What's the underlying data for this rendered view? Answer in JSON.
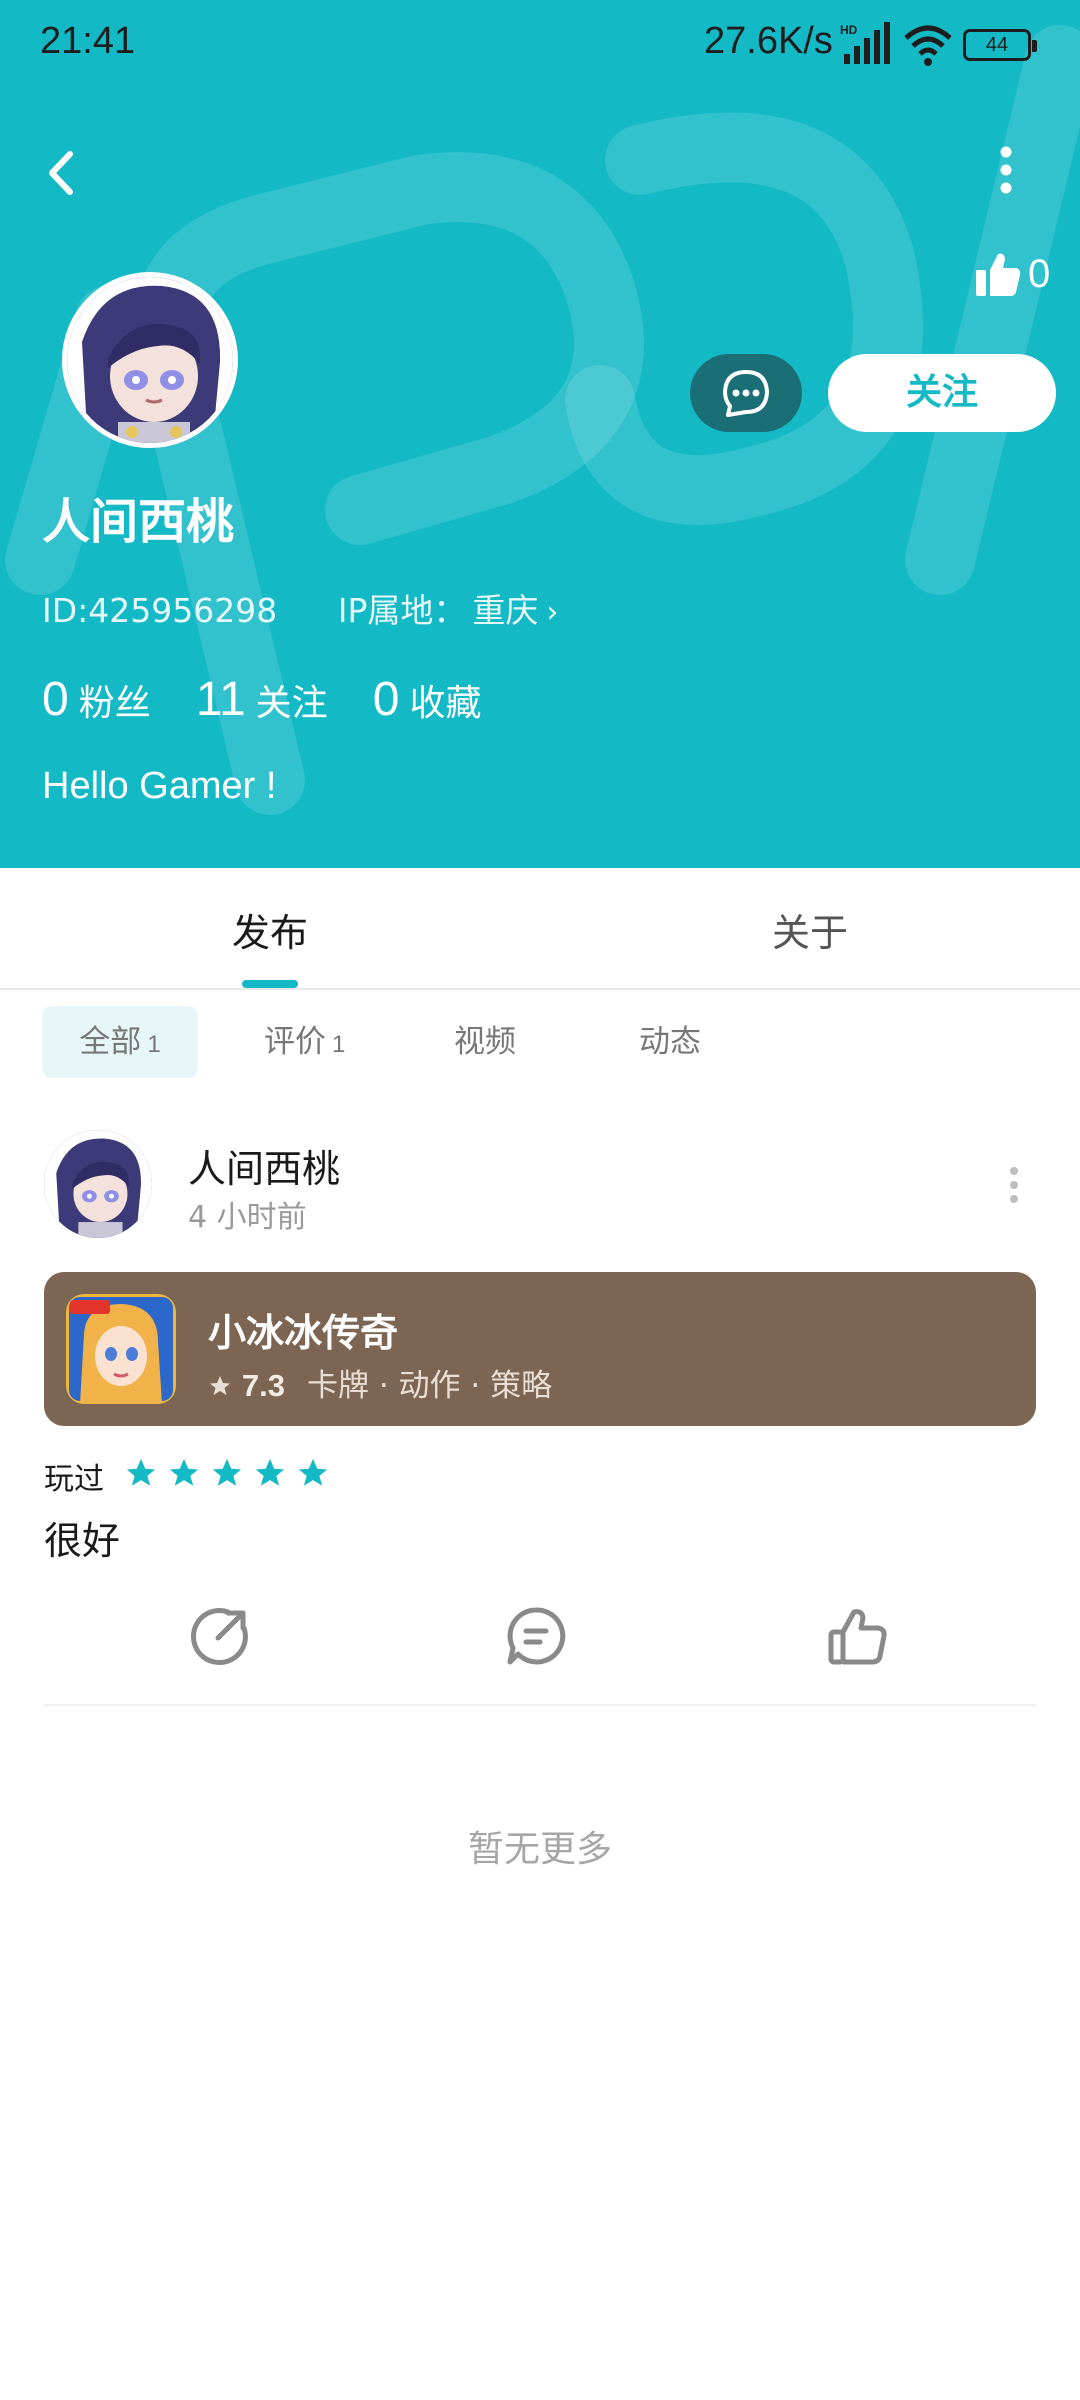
{
  "status_bar": {
    "time": "21:41",
    "net_speed": "27.6K/s",
    "network_badge": "HD",
    "battery": "44"
  },
  "header": {
    "accent_color": "#14b9c6",
    "like_count": "0",
    "follow_label": "关注",
    "username": "人间西桃",
    "user_id": "ID:425956298",
    "ip_label": "IP属地：",
    "ip_city": "重庆",
    "stats": [
      {
        "value": "0",
        "label": "粉丝"
      },
      {
        "value": "11",
        "label": "关注"
      },
      {
        "value": "0",
        "label": "收藏"
      }
    ],
    "bio": "Hello Gamer !"
  },
  "tabs": {
    "publish": "发布",
    "about": "关于"
  },
  "filters": {
    "all_label": "全部",
    "all_count": "1",
    "review_label": "评价",
    "review_count": "1",
    "video_label": "视频",
    "dynamic_label": "动态"
  },
  "post": {
    "author": "人间西桃",
    "time": "4 小时前",
    "game": {
      "name": "小冰冰传奇",
      "rating": "7.3",
      "tags": "卡牌 · 动作 · 策略",
      "card_color": "#7c6653"
    },
    "played_label": "玩过",
    "stars": 5,
    "review": "很好"
  },
  "footer": {
    "no_more": "暂无更多"
  }
}
